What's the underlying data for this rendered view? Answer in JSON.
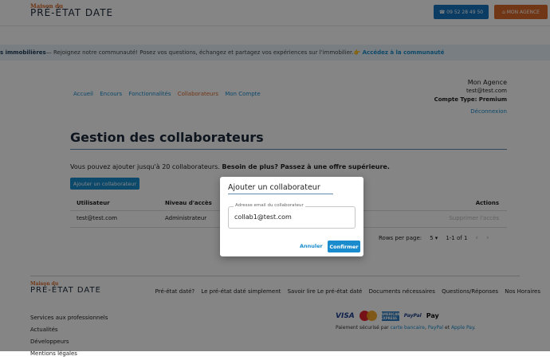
{
  "header": {
    "logo_small": "Maison du",
    "logo_big": "PRÉ-ÉTAT DATE",
    "phone_label": "☎ 09 52 28 49 50",
    "agency_label": "⌂ MON AGENCE"
  },
  "banner": {
    "part1": "s immobilières",
    "part2": " — Rejoignez notre communauté! Posez vos questions, échangez et partagez vos expériences sur l'immobilier. ",
    "part3": "👉 Accédez à la communauté"
  },
  "nav": {
    "items": [
      "Accueil",
      "Encours",
      "Fonctionnalités",
      "Collaborateurs",
      "Mon Compte"
    ]
  },
  "account": {
    "agency": "Mon Agence",
    "email": "test@test.com",
    "type_label": "Compte Type:",
    "type_value": "Premium",
    "logout": "Déconnexion"
  },
  "page": {
    "title": "Gestion des collaborateurs",
    "intro_normal": "Vous pouvez ajouter jusqu'à 20 collaborateurs. ",
    "intro_bold": "Besoin de plus? Passez à une offre supérieure.",
    "add_button": "Ajouter un collaborateur"
  },
  "table": {
    "headers": [
      "Utilisateur",
      "Niveau d'accès",
      "Actions"
    ],
    "rows": [
      {
        "user": "test@test.com",
        "level": "Administrateur",
        "action": "Supprimer l'accès"
      }
    ]
  },
  "pagination": {
    "rows_label": "Rows per page:",
    "rows_value": "5 ▾",
    "range": "1-1 of 1",
    "prev": "‹",
    "next": "›"
  },
  "modal": {
    "title": "Ajouter un collaborateur",
    "field_label": "Adresse email du collaborateur",
    "field_value": "collab1@test.com",
    "cancel": "Annuler",
    "confirm": "Confirmer"
  },
  "footer": {
    "logo_small": "Maison du",
    "logo_big": "PRÉ-ÉTAT DATE",
    "nav": [
      "Pré-état daté?",
      "Le pré-état daté simplement",
      "Savoir lire Le pré-état daté",
      "Documents nécessaires",
      "Questions/Réponses",
      "Nos Horaires"
    ],
    "links": [
      "Services aux professionnels",
      "Actualités",
      "Développeurs",
      "Mentions légales"
    ],
    "cards": {
      "visa": "VISA",
      "amex": "AMERICAN EXPRESS",
      "paypal": "PayPal",
      "apple": " Pay"
    },
    "secure_text": "Paiement sécurisé par ",
    "secure_link1": "carte bancaire",
    "secure_sep1": ", ",
    "secure_link2": "PayPal",
    "secure_sep2": " et ",
    "secure_link3": "Apple Pay",
    "secure_end": "."
  }
}
